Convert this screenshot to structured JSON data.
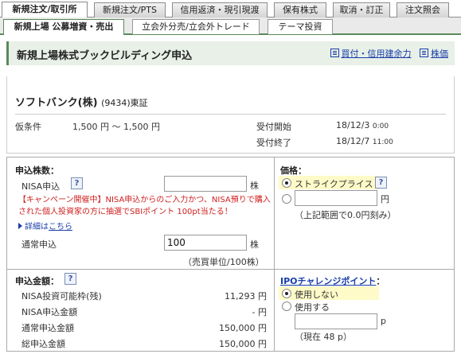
{
  "top_tabs": [
    "新規注文/取引所",
    "新規注文/PTS",
    "信用返済・現引現渡",
    "保有株式",
    "取消・訂正",
    "注文照会"
  ],
  "sub_tabs": [
    "新規上場 公募増資・売出",
    "立会外分売/立会外トレード",
    "テーマ投資"
  ],
  "title": "新規上場株式ブックビルディング申込",
  "links": {
    "margin": "買付・信用建余力",
    "price": "株価"
  },
  "stock": {
    "name": "ソフトバンク(株)",
    "code": "(9434)東証",
    "kari_label": "仮条件",
    "kari_value": "1,500 円 〜 1,500 円",
    "start_label": "受付開始",
    "start_date": "18/12/3",
    "start_time": "0:00",
    "end_label": "受付終了",
    "end_date": "18/12/7",
    "end_time": "11:00"
  },
  "shares": {
    "head": "申込株数：",
    "nisa_label": "NISA申込",
    "nisa_value": "",
    "unit": "株",
    "campaign_text": "【キャンペーン開催中】NISA申込からのご入力かつ、NISA預りで購入された個人投資家の方に抽選でSBIポイント 100pt当たる！",
    "detail_prefix": "詳細は",
    "detail_link": "こちら",
    "normal_label": "通常申込",
    "normal_value": "100",
    "unit_note": "（売買単位/100株）"
  },
  "price": {
    "head": "価格：",
    "strike": "ストライクプライス",
    "strike_selected": true,
    "custom_value": "",
    "yen": "円",
    "range_note": "（上記範囲で0.0円刻み）"
  },
  "amount": {
    "head": "申込金額：",
    "rows": [
      {
        "label": "NISA投資可能枠(残)",
        "value": "11,293 円"
      },
      {
        "label": "NISA申込金額",
        "value": "- 円"
      },
      {
        "label": "通常申込金額",
        "value": "150,000 円"
      },
      {
        "label": "総申込金額",
        "value": "150,000 円"
      }
    ]
  },
  "ipo": {
    "head": "IPOチャレンジポイント",
    "colon": "：",
    "no_use": "使用しない",
    "use": "使用する",
    "no_use_selected": true,
    "points_value": "",
    "unit": "p",
    "current": "（現在 48 p）"
  },
  "help_icon": "question-icon",
  "colors": {
    "accent": "#5a8a5a",
    "link": "#1a3ea8",
    "warn": "#d02020",
    "highlight": "#fffbc8"
  }
}
